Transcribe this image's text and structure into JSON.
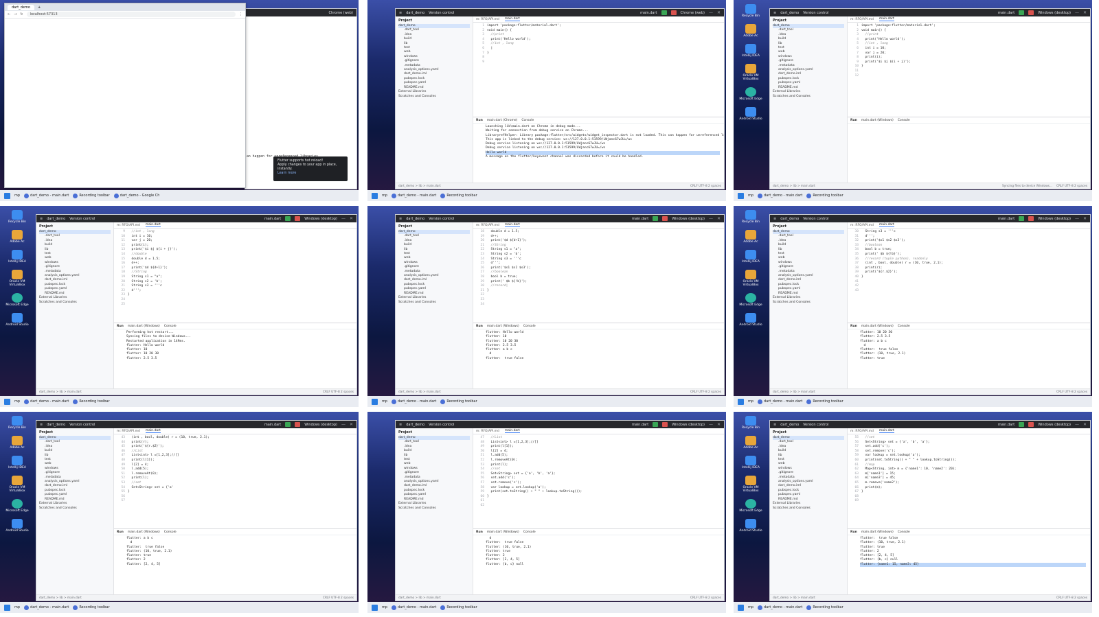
{
  "taskbar": {
    "search": "mp",
    "items": [
      "dart_demo - main.dart",
      "Recording toolbar",
      "dart_demo - Google Ch"
    ]
  },
  "taskbar_short": {
    "items": [
      "dart_demo - main.dart",
      "Recording toolbar"
    ]
  },
  "desktop_icons": [
    "Recycle Bin",
    "Adobe Ac",
    "Intellij IDEA",
    "Oracle VM VirtualBox",
    "Microsoft Edge",
    "Android Studio"
  ],
  "ide": {
    "project_label": "dart_demo",
    "vcs_label": "Version control",
    "config_label": "main.dart",
    "device_label": "Windows (desktop)",
    "device_chrome": "Chrome (web)",
    "project_header": "Project",
    "tree": [
      "dart_demo",
      ".dart_tool",
      ".idea",
      "build",
      "lib",
      "test",
      "web",
      "windows",
      ".gitignore",
      ".metadata",
      "analysis_options.yaml",
      "dart_demo.iml",
      "pubspec.lock",
      "pubspec.yaml",
      "README.md",
      "External Libraries",
      "Scratches and Consoles"
    ],
    "tab_inactive": "m: RFO/API.md",
    "tab_active": "main.dart",
    "run_label": "Run",
    "run_tab": "main.dart (Windows)",
    "run_tab_chrome": "main.dart (Chrome)",
    "console_label": "Console",
    "status_path": "dart_demo > lib > main.dart",
    "status_right": "CRLF  UTF-8  2 spaces"
  },
  "chrome": {
    "tab": "dart_demo",
    "url": "localhost:57313"
  },
  "toast": {
    "title": "Flutter supports hot reload!",
    "body": "Apply changes to your app in place, instantly.",
    "link": "Learn more"
  },
  "behind_msg": "an happen for unreferenced libraries.",
  "panels": [
    {
      "code": [
        {
          "n": "1",
          "t": "import 'package:flutter/material.dart';"
        },
        {
          "n": "2",
          "t": ""
        },
        {
          "n": "3",
          "t": "void main() {"
        },
        {
          "n": "4",
          "t": "  //print"
        },
        {
          "n": "5",
          "t": "  print('Hello world');"
        },
        {
          "n": "6",
          "t": ""
        },
        {
          "n": "7",
          "t": "  //int , long"
        },
        {
          "n": "8",
          "t": "  |"
        },
        {
          "n": "9",
          "t": "}"
        }
      ],
      "console": [
        "Launching lib\\main.dart on Chrome in debug mode...",
        "Waiting for connection from debug service on Chrome...",
        "LibraryrefHelper: Library package:flutter/src/widgets/widget_inspector.dart is not loaded. This can happen for unreferenced libraries.",
        "This app is linked to the debug service: ws://127.0.0.1:51599/LWjanc67wJU=/ws",
        "Debug service listening on ws://127.0.0.1:51599/LWjanc67wJU=/ws",
        "Debug service listening on ws://127.0.0.1:51599/LWjanc67wJU=/ws",
        "Hello world",
        "A message on the flutter/keyevent channel was discarded before it could be handled."
      ]
    },
    {
      "code": [
        {
          "n": "1",
          "t": "import 'package:flutter/material.dart';"
        },
        {
          "n": "2",
          "t": ""
        },
        {
          "n": "3",
          "t": "void main() {"
        },
        {
          "n": "4",
          "t": "  //print"
        },
        {
          "n": "5",
          "t": "  print('Hello world');"
        },
        {
          "n": "6",
          "t": ""
        },
        {
          "n": "7",
          "t": "  //int , long"
        },
        {
          "n": "8",
          "t": "  int i = 10;"
        },
        {
          "n": "9",
          "t": "  var j = 20;"
        },
        {
          "n": "10",
          "t": "  print(i);"
        },
        {
          "n": "11",
          "t": "  print('$i $j $(i + j)');"
        },
        {
          "n": "12",
          "t": "}"
        }
      ],
      "console": [],
      "status_extra": "Syncing files to device Windows..."
    },
    {
      "code": [
        {
          "n": "9",
          "t": "  //int , long"
        },
        {
          "n": "10",
          "t": "  int i = 10;"
        },
        {
          "n": "11",
          "t": "  var j = 20;"
        },
        {
          "n": "12",
          "t": "  print(i);"
        },
        {
          "n": "13",
          "t": "  print('$i $j ${i + j}');"
        },
        {
          "n": "14",
          "t": ""
        },
        {
          "n": "15",
          "t": "  //double"
        },
        {
          "n": "16",
          "t": "  double d = 1.5;"
        },
        {
          "n": "17",
          "t": "  d++;"
        },
        {
          "n": "18",
          "t": "  print('$d ${d+1}');"
        },
        {
          "n": "19",
          "t": ""
        },
        {
          "n": "20",
          "t": "  //String"
        },
        {
          "n": "21",
          "t": "  String s1 = \"a\";"
        },
        {
          "n": "22",
          "t": "  String s2 = 'b';"
        },
        {
          "n": "23",
          "t": "  String s3 = '''c"
        },
        {
          "n": "24",
          "t": "  d''';"
        },
        {
          "n": "25",
          "t": "}"
        }
      ],
      "console": [
        "Performing hot restart...",
        "Syncing files to device Windows...",
        "Restarted application in 149ms.",
        "flutter: Hello world",
        "flutter: 10",
        "flutter: 10 20 30",
        "flutter: 2.5 3.5"
      ]
    },
    {
      "code": [
        {
          "n": "18",
          "t": "  double d = 1.5;"
        },
        {
          "n": "19",
          "t": "  d++;"
        },
        {
          "n": "20",
          "t": "  print('$d ${d+1}');"
        },
        {
          "n": "21",
          "t": ""
        },
        {
          "n": "22",
          "t": "  //String"
        },
        {
          "n": "23",
          "t": "  String s1 = \"a\";"
        },
        {
          "n": "24",
          "t": "  String s2 = 'b';"
        },
        {
          "n": "25",
          "t": "  String s3 = '''c"
        },
        {
          "n": "26",
          "t": "  d''';"
        },
        {
          "n": "27",
          "t": "  print('$s1 $s2 $s3');"
        },
        {
          "n": "28",
          "t": ""
        },
        {
          "n": "29",
          "t": "  //boolean"
        },
        {
          "n": "30",
          "t": "  bool b = true;"
        },
        {
          "n": "31",
          "t": "  print(' $b ${!b}');"
        },
        {
          "n": "32",
          "t": ""
        },
        {
          "n": "33",
          "t": "  //record|"
        },
        {
          "n": "34",
          "t": "}"
        }
      ],
      "console": [
        "flutter: Hello world",
        "flutter: 10",
        "flutter: 10 20 30",
        "flutter: 2.5 3.5",
        "flutter: a b c",
        "  d",
        "flutter:  true false"
      ]
    },
    {
      "code": [
        {
          "n": "30",
          "t": "  String s3 = '''c"
        },
        {
          "n": "31",
          "t": "  d''';"
        },
        {
          "n": "32",
          "t": "  print('$s1 $s2 $s3');"
        },
        {
          "n": "33",
          "t": ""
        },
        {
          "n": "34",
          "t": "  //boolean"
        },
        {
          "n": "35",
          "t": "  bool b = true;"
        },
        {
          "n": "36",
          "t": "  print(' $b ${!b}');"
        },
        {
          "n": "37",
          "t": ""
        },
        {
          "n": "38",
          "t": "  //record (tuple python), readonly"
        },
        {
          "n": "39",
          "t": "  (int , bool, double) r = (10, true, 2.1);"
        },
        {
          "n": "40",
          "t": "  print(r);"
        },
        {
          "n": "41",
          "t": "  print('${r.$2}');"
        },
        {
          "n": "42",
          "t": ""
        },
        {
          "n": "43",
          "t": "}"
        }
      ],
      "console": [
        "flutter: 10 20 30",
        "flutter: 2.5 3.5",
        "flutter: a b c",
        "  d",
        "flutter:  true false",
        "flutter: (10, true, 2.1)",
        "flutter: true"
      ]
    },
    {
      "code": [
        {
          "n": "43",
          "t": "  (int , bool, double) r = (10, true, 2.1);"
        },
        {
          "n": "44",
          "t": "  print(r);"
        },
        {
          "n": "45",
          "t": "  print('${r.$2}');"
        },
        {
          "n": "46",
          "t": ""
        },
        {
          "n": "47",
          "t": "  //List"
        },
        {
          "n": "48",
          "t": "  List<int> l =[1,2,3];//[]"
        },
        {
          "n": "49",
          "t": "  print(l[1]);"
        },
        {
          "n": "50",
          "t": "  l[2] = 4;"
        },
        {
          "n": "51",
          "t": "  l.add(5);"
        },
        {
          "n": "52",
          "t": "  l.removeAt(0);"
        },
        {
          "n": "53",
          "t": "  print(l);"
        },
        {
          "n": "54",
          "t": ""
        },
        {
          "n": "55",
          "t": "  //set"
        },
        {
          "n": "56",
          "t": "  Set<String> set = {'a'"
        },
        {
          "n": "57",
          "t": "}"
        }
      ],
      "console": [
        "flutter: a b c",
        "  d",
        "flutter:  true false",
        "flutter: (10, true, 2.1)",
        "flutter: true",
        "flutter: 2",
        "flutter: [2, 4, 5]"
      ]
    },
    {
      "code": [
        {
          "n": "47",
          "t": "  //List"
        },
        {
          "n": "48",
          "t": "  List<int> l =[1,2,3];//[]"
        },
        {
          "n": "49",
          "t": "  print(l[1]);"
        },
        {
          "n": "50",
          "t": "  l[2] = 4;"
        },
        {
          "n": "51",
          "t": "  l.add(5);"
        },
        {
          "n": "52",
          "t": "  l.removeAt(0);"
        },
        {
          "n": "53",
          "t": "  print(l);"
        },
        {
          "n": "54",
          "t": ""
        },
        {
          "n": "55",
          "t": "  //set"
        },
        {
          "n": "56",
          "t": "  Set<String> set = {'a', 'b', 'a'};"
        },
        {
          "n": "57",
          "t": "  set.add('c');"
        },
        {
          "n": "58",
          "t": "  set.remove('c');"
        },
        {
          "n": "59",
          "t": "  var lookup = set.lookup('a');"
        },
        {
          "n": "60",
          "t": ""
        },
        {
          "n": "61",
          "t": "  print(set.toString() + \" \" + lookup.toString());"
        },
        {
          "n": "62",
          "t": "}"
        }
      ],
      "console": [
        "  d",
        "flutter:  true false",
        "flutter: (10, true, 2.1)",
        "flutter: true",
        "flutter: 2",
        "flutter: [2, 4, 5]",
        "flutter: {b, c} null"
      ]
    },
    {
      "code": [
        {
          "n": "55",
          "t": "  //set"
        },
        {
          "n": "56",
          "t": "  Set<String> set = {'a', 'b', 'a'};"
        },
        {
          "n": "57",
          "t": "  set.add('c');"
        },
        {
          "n": "58",
          "t": "  set.remove('c');"
        },
        {
          "n": "59",
          "t": "  var lookup = set.lookup('a');"
        },
        {
          "n": "60",
          "t": ""
        },
        {
          "n": "61",
          "t": "  print(set.toString() + \" \" + lookup.toString());"
        },
        {
          "n": "62",
          "t": ""
        },
        {
          "n": "63",
          "t": "  //map"
        },
        {
          "n": "64",
          "t": "  Map<String, int> m = {'name1': 10, 'name2': 20};"
        },
        {
          "n": "65",
          "t": "  m['name1'] = 15;"
        },
        {
          "n": "66",
          "t": "  m['name3'] = 45;"
        },
        {
          "n": "67",
          "t": "  m.remove('name2');"
        },
        {
          "n": "68",
          "t": "  print(m);"
        },
        {
          "n": "69",
          "t": "}"
        }
      ],
      "console": [
        "flutter:  true false",
        "flutter: (10, true, 2.1)",
        "flutter: true",
        "flutter: 2",
        "flutter: [2, 4, 5]",
        "flutter: {b, c} null",
        "flutter: {name1: 15, name3: 45}"
      ]
    }
  ]
}
